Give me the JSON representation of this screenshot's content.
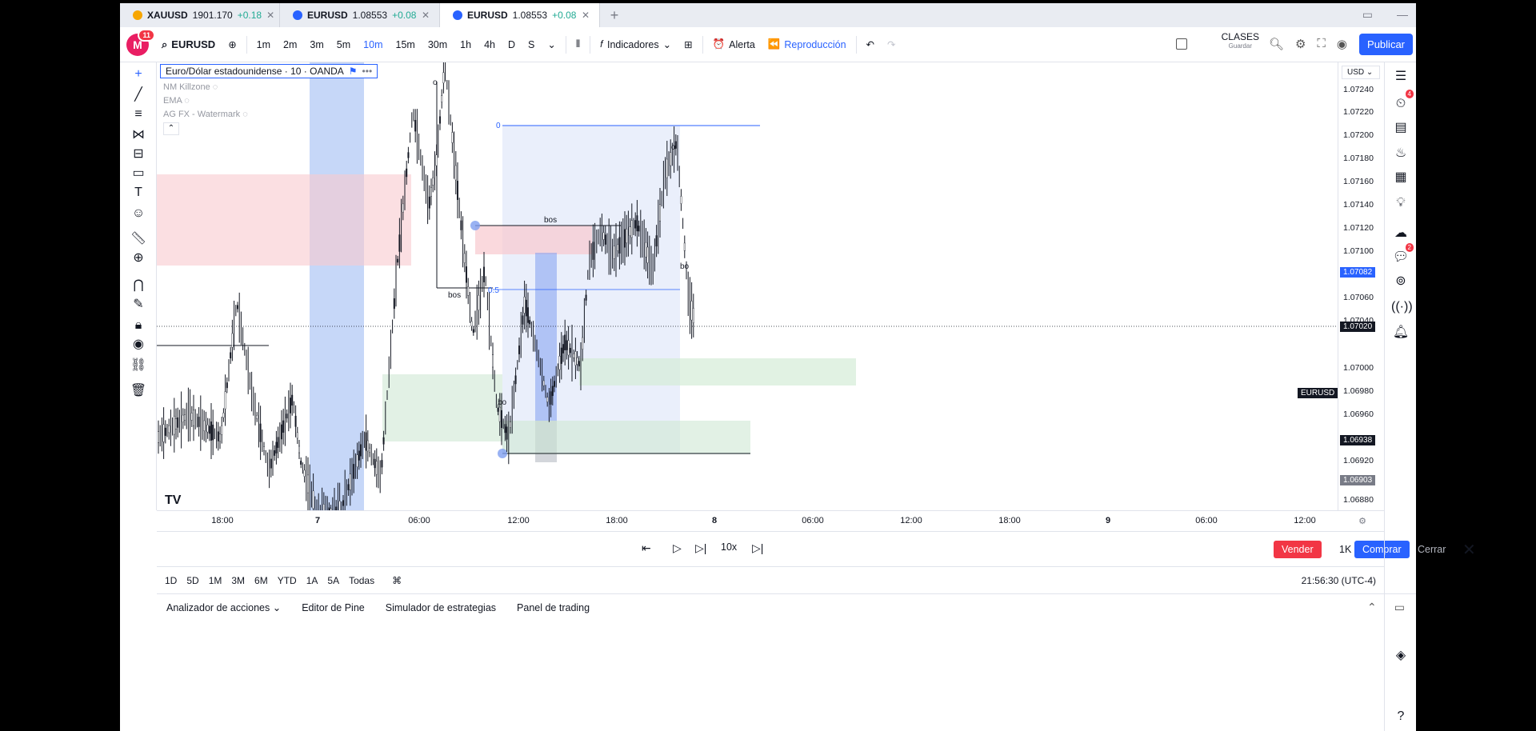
{
  "tabs": [
    {
      "symbol": "XAUUSD",
      "price": "1901.170",
      "change": "+0.18",
      "icon": "gold-coin-icon"
    },
    {
      "symbol": "EURUSD",
      "price": "1.08553",
      "change": "+0.08",
      "icon": "euro-icon"
    },
    {
      "symbol": "EURUSD",
      "price": "1.08553",
      "change": "+0.08",
      "icon": "euro-icon"
    }
  ],
  "toolbar": {
    "avatar_letter": "M",
    "avatar_badge": "11",
    "symbol": "EURUSD",
    "intervals": [
      "1m",
      "2m",
      "3m",
      "5m",
      "10m",
      "15m",
      "30m",
      "1h",
      "4h",
      "D",
      "S"
    ],
    "active_interval": "10m",
    "indicators": "Indicadores",
    "alert": "Alerta",
    "replay": "Reproducción",
    "clases": "CLASES",
    "clases_sub": "Guardar",
    "publish": "Publicar"
  },
  "legend": {
    "title": "Euro/Dólar estadounidense · 10 · OANDA",
    "indicators": [
      "NM Killzone",
      "EMA",
      "AG FX - Watermark"
    ]
  },
  "currency": "USD",
  "price_axis": {
    "labels": [
      "1.07240",
      "1.07220",
      "1.07200",
      "1.07180",
      "1.07160",
      "1.07140",
      "1.07120",
      "1.07100",
      "1.07060",
      "1.07040",
      "1.07000",
      "1.06980",
      "1.06960",
      "1.06920",
      "1.06880"
    ],
    "tag_current": "1.07082",
    "tag_symbol": "EURUSD",
    "tag_last": "1.07020",
    "tag_1": "1.06938",
    "tag_2": "1.06903"
  },
  "time_axis": [
    "18:00",
    "7",
    "06:00",
    "12:00",
    "18:00",
    "8",
    "06:00",
    "12:00",
    "18:00",
    "9",
    "06:00",
    "12:00"
  ],
  "annotations": {
    "bos1": "bos",
    "bos2": "bos",
    "bos3": "bo",
    "bos4": "bo",
    "fib0": "0",
    "fib05": "0.5",
    "o1": "o",
    "o2": "o"
  },
  "replay": {
    "speed": "10x",
    "sell": "Vender",
    "qty": "1K",
    "buy": "Comprar",
    "close": "Cerrar"
  },
  "periods": [
    "1D",
    "5D",
    "1M",
    "3M",
    "6M",
    "YTD",
    "1A",
    "5A",
    "Todas"
  ],
  "clock": "21:56:30 (UTC-4)",
  "bottom_tabs": [
    "Analizador de acciones",
    "Editor de Pine",
    "Simulador de estrategias",
    "Panel de trading"
  ],
  "colors": {
    "accent": "#2962ff",
    "sell": "#f23645",
    "buy": "#2962ff",
    "positive": "#22ab94"
  }
}
